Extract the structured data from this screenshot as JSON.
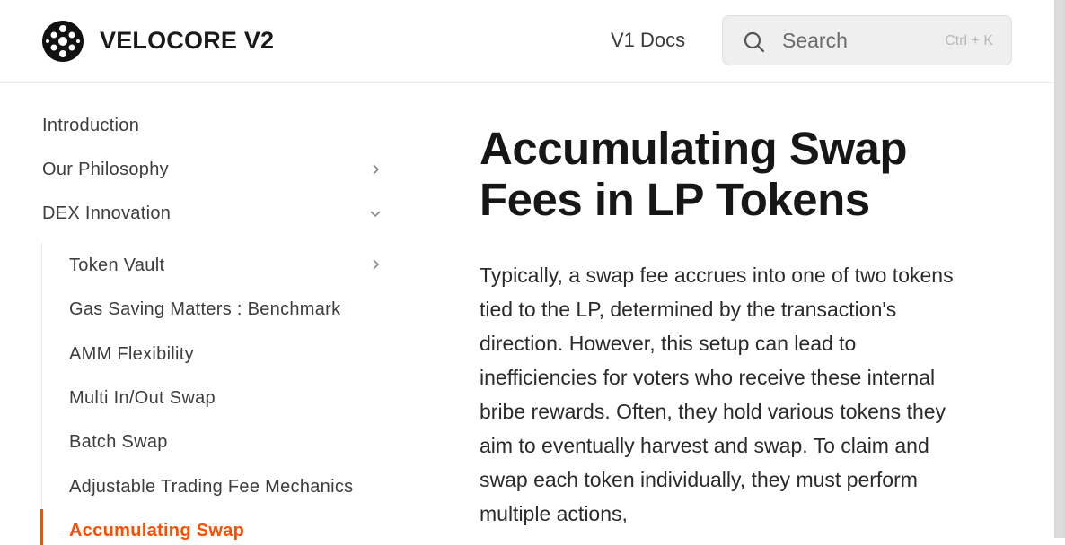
{
  "header": {
    "brand": "VELOCORE V2",
    "v1_docs_link": "V1 Docs",
    "search": {
      "placeholder": "Search",
      "shortcut": "Ctrl + K"
    }
  },
  "sidebar": {
    "items": [
      {
        "label": "Introduction"
      },
      {
        "label": "Our Philosophy",
        "expandable": true,
        "expanded": false
      },
      {
        "label": "DEX Innovation",
        "expandable": true,
        "expanded": true
      }
    ],
    "sub_items": [
      {
        "label": "Token Vault",
        "expandable": true
      },
      {
        "label": "Gas Saving Matters : Benchmark"
      },
      {
        "label": "AMM Flexibility"
      },
      {
        "label": "Multi In/Out Swap"
      },
      {
        "label": "Batch Swap"
      },
      {
        "label": "Adjustable Trading Fee Mechanics"
      },
      {
        "label": "Accumulating Swap",
        "active": true
      }
    ]
  },
  "content": {
    "title": "Accumulating Swap Fees in LP Tokens",
    "paragraph": "Typically, a swap fee accrues into one of two tokens tied to the LP, determined by the transaction's direction. However, this setup can lead to inefficiencies for voters who receive these internal bribe rewards. Often, they hold various tokens they aim to eventually harvest and swap. To claim and swap each token individually, they must perform multiple actions,"
  },
  "colors": {
    "accent": "#ff4d00",
    "text": "#1f1f1f",
    "muted": "#6b6b6b"
  },
  "icons": [
    "velocore-logo-icon",
    "search-icon",
    "chevron-right-icon",
    "chevron-down-icon"
  ]
}
